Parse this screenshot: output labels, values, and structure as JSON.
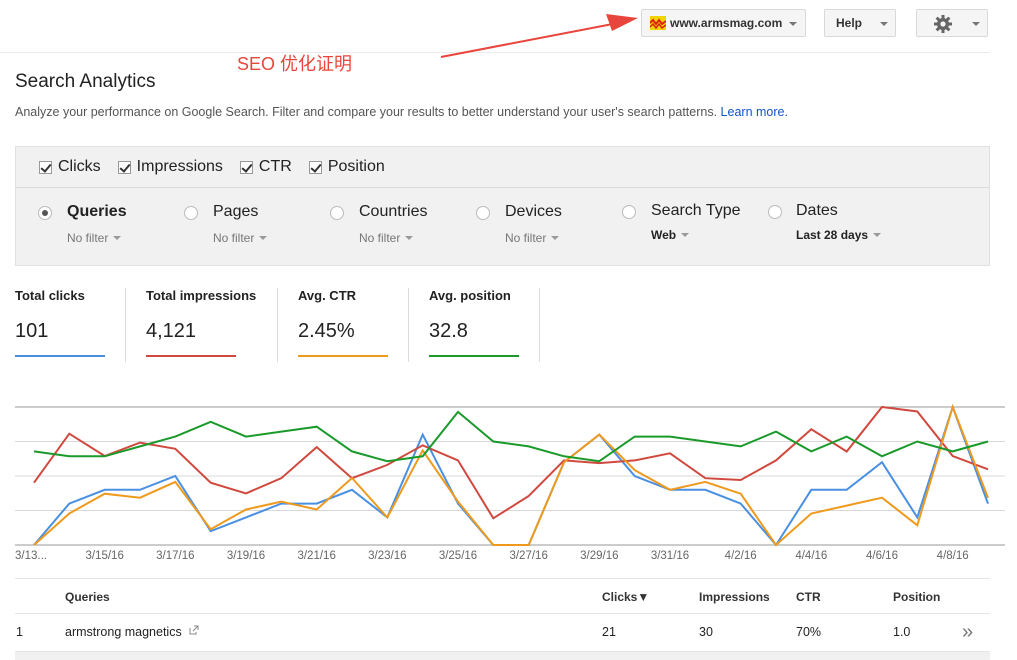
{
  "topbar": {
    "site": "www.armsmag.com",
    "help": "Help"
  },
  "annotation": "SEO 优化证明",
  "page": {
    "title": "Search Analytics",
    "description": "Analyze your performance on Google Search. Filter and compare your results to better understand your user's search patterns.",
    "learn_more": "Learn more."
  },
  "metrics": [
    {
      "label": "Clicks",
      "checked": true
    },
    {
      "label": "Impressions",
      "checked": true
    },
    {
      "label": "CTR",
      "checked": true
    },
    {
      "label": "Position",
      "checked": true
    }
  ],
  "dimensions": [
    {
      "label": "Queries",
      "sub": "No filter",
      "selected": true
    },
    {
      "label": "Pages",
      "sub": "No filter",
      "selected": false
    },
    {
      "label": "Countries",
      "sub": "No filter",
      "selected": false
    },
    {
      "label": "Devices",
      "sub": "No filter",
      "selected": false
    },
    {
      "label": "Search Type",
      "sub": "Web",
      "selected": false
    },
    {
      "label": "Dates",
      "sub": "Last 28 days",
      "selected": false
    }
  ],
  "totals": [
    {
      "label": "Total clicks",
      "value": "101",
      "color": "#4a90e2"
    },
    {
      "label": "Total impressions",
      "value": "4,121",
      "color": "#d0493e"
    },
    {
      "label": "Avg. CTR",
      "value": "2.45%",
      "color": "#ee9a1d"
    },
    {
      "label": "Avg. position",
      "value": "32.8",
      "color": "#1a9a2a"
    }
  ],
  "chart_data": {
    "type": "line",
    "x": [
      "3/13",
      "3/14",
      "3/15",
      "3/16",
      "3/17",
      "3/18",
      "3/19",
      "3/20",
      "3/21",
      "3/22",
      "3/23",
      "3/24",
      "3/25",
      "3/26",
      "3/27",
      "3/28",
      "3/29",
      "3/30",
      "3/31",
      "4/1",
      "4/2",
      "4/3",
      "4/4",
      "4/5",
      "4/6",
      "4/7",
      "4/8",
      "4/9"
    ],
    "x_tick_labels": [
      "3/13...",
      "3/15/16",
      "3/17/16",
      "3/19/16",
      "3/21/16",
      "3/23/16",
      "3/25/16",
      "3/27/16",
      "3/29/16",
      "3/31/16",
      "4/2/16",
      "4/4/16",
      "4/6/16",
      "4/8/16"
    ],
    "grid": true,
    "series": [
      {
        "name": "Clicks",
        "color": "#4a90e2",
        "values": [
          0,
          3,
          4,
          4,
          5,
          1,
          2,
          3,
          3,
          4,
          2,
          8,
          3,
          0,
          0,
          6,
          8,
          5,
          4,
          4,
          3,
          0,
          4,
          4,
          6,
          2,
          10,
          3
        ]
      },
      {
        "name": "Impressions",
        "color": "#d0493e",
        "values": [
          180,
          235,
          210,
          225,
          218,
          180,
          168,
          185,
          220,
          185,
          200,
          222,
          205,
          140,
          165,
          205,
          202,
          205,
          213,
          185,
          183,
          205,
          240,
          215,
          265,
          260,
          210,
          195
        ]
      },
      {
        "name": "CTR",
        "color": "#ee9a1d",
        "values": [
          0,
          8,
          13,
          12,
          16,
          4,
          9,
          11,
          9,
          17,
          7,
          24,
          11,
          0,
          0,
          21,
          28,
          19,
          14,
          16,
          13,
          0,
          8,
          10,
          12,
          5,
          35,
          12
        ]
      },
      {
        "name": "Position",
        "color": "#1a9a2a",
        "values": [
          44,
          43,
          43,
          45,
          47,
          50,
          47,
          48,
          49,
          44,
          42,
          43,
          52,
          46,
          45,
          43,
          42,
          47,
          47,
          46,
          45,
          48,
          44,
          47,
          43,
          46,
          44,
          46
        ]
      }
    ]
  },
  "table": {
    "headers": {
      "queries": "Queries",
      "clicks": "Clicks▼",
      "impressions": "Impressions",
      "ctr": "CTR",
      "position": "Position"
    },
    "rows": [
      {
        "index": "1",
        "query": "armstrong magnetics",
        "clicks": "21",
        "impressions": "30",
        "ctr": "70%",
        "position": "1.0"
      }
    ],
    "more": "»"
  }
}
